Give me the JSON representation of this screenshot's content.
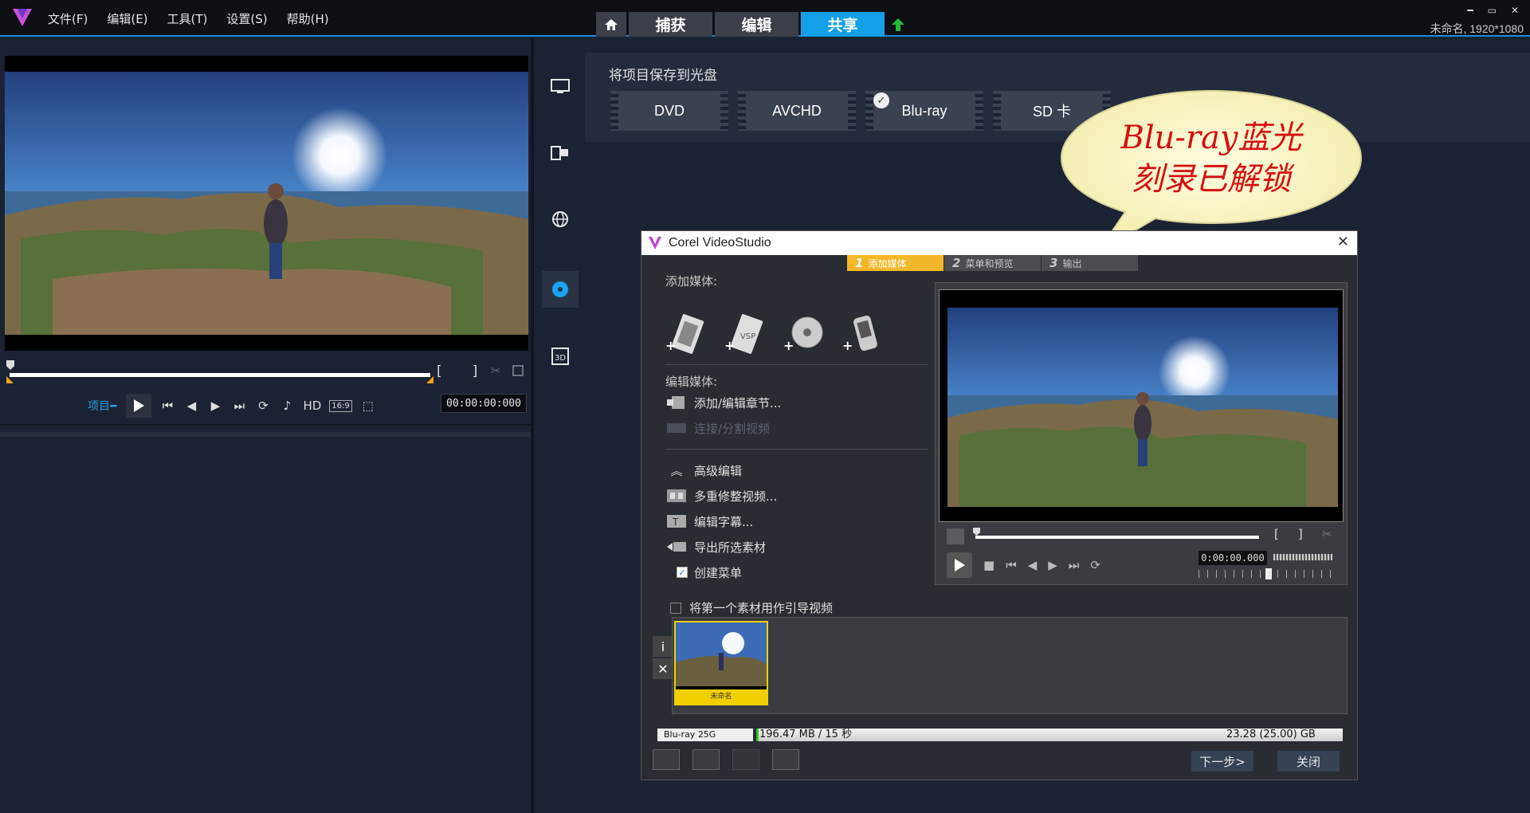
{
  "menu": {
    "file": "文件(F)",
    "edit": "编辑(E)",
    "tools": "工具(T)",
    "settings": "设置(S)",
    "help": "帮助(H)"
  },
  "modes": {
    "capture": "捕获",
    "edit": "编辑",
    "share": "共享"
  },
  "window": {
    "minimize": "━",
    "restore": "▭",
    "close": "✕",
    "project_name": "未命名, 1920*1080"
  },
  "player": {
    "project_label": "项目━",
    "hd": "HD",
    "ratio": "16:9",
    "timecode": "00:00:00:000"
  },
  "share": {
    "title": "将项目保存到光盘",
    "discs": [
      "DVD",
      "AVCHD",
      "Blu-ray",
      "SD 卡"
    ]
  },
  "annotation": {
    "line1": "Blu-ray蓝光",
    "line2": "刻录已解锁"
  },
  "dialog": {
    "title": "Corel VideoStudio",
    "steps": [
      {
        "num": "1",
        "label": "添加媒体"
      },
      {
        "num": "2",
        "label": "菜单和预览"
      },
      {
        "num": "3",
        "label": "输出"
      }
    ],
    "add_media_label": "添加媒体:",
    "edit_media_label": "编辑媒体:",
    "add_chapter": "添加/编辑章节...",
    "join_split": "连接/分割视频",
    "advanced": "高级编辑",
    "multi_trim": "多重修整视频...",
    "edit_subtitle": "编辑字幕...",
    "export_selected": "导出所选素材",
    "create_menu": "创建菜单",
    "first_as_intro": "将第一个素材用作引导视频",
    "clip_name": "未命名",
    "timecode": "0:00:00.000",
    "disc_type": "Blu-ray 25G",
    "used": "196.47 MB / 15 秒",
    "capacity": "23.28 (25.00) GB",
    "next": "下一步>",
    "close": "关闭"
  }
}
